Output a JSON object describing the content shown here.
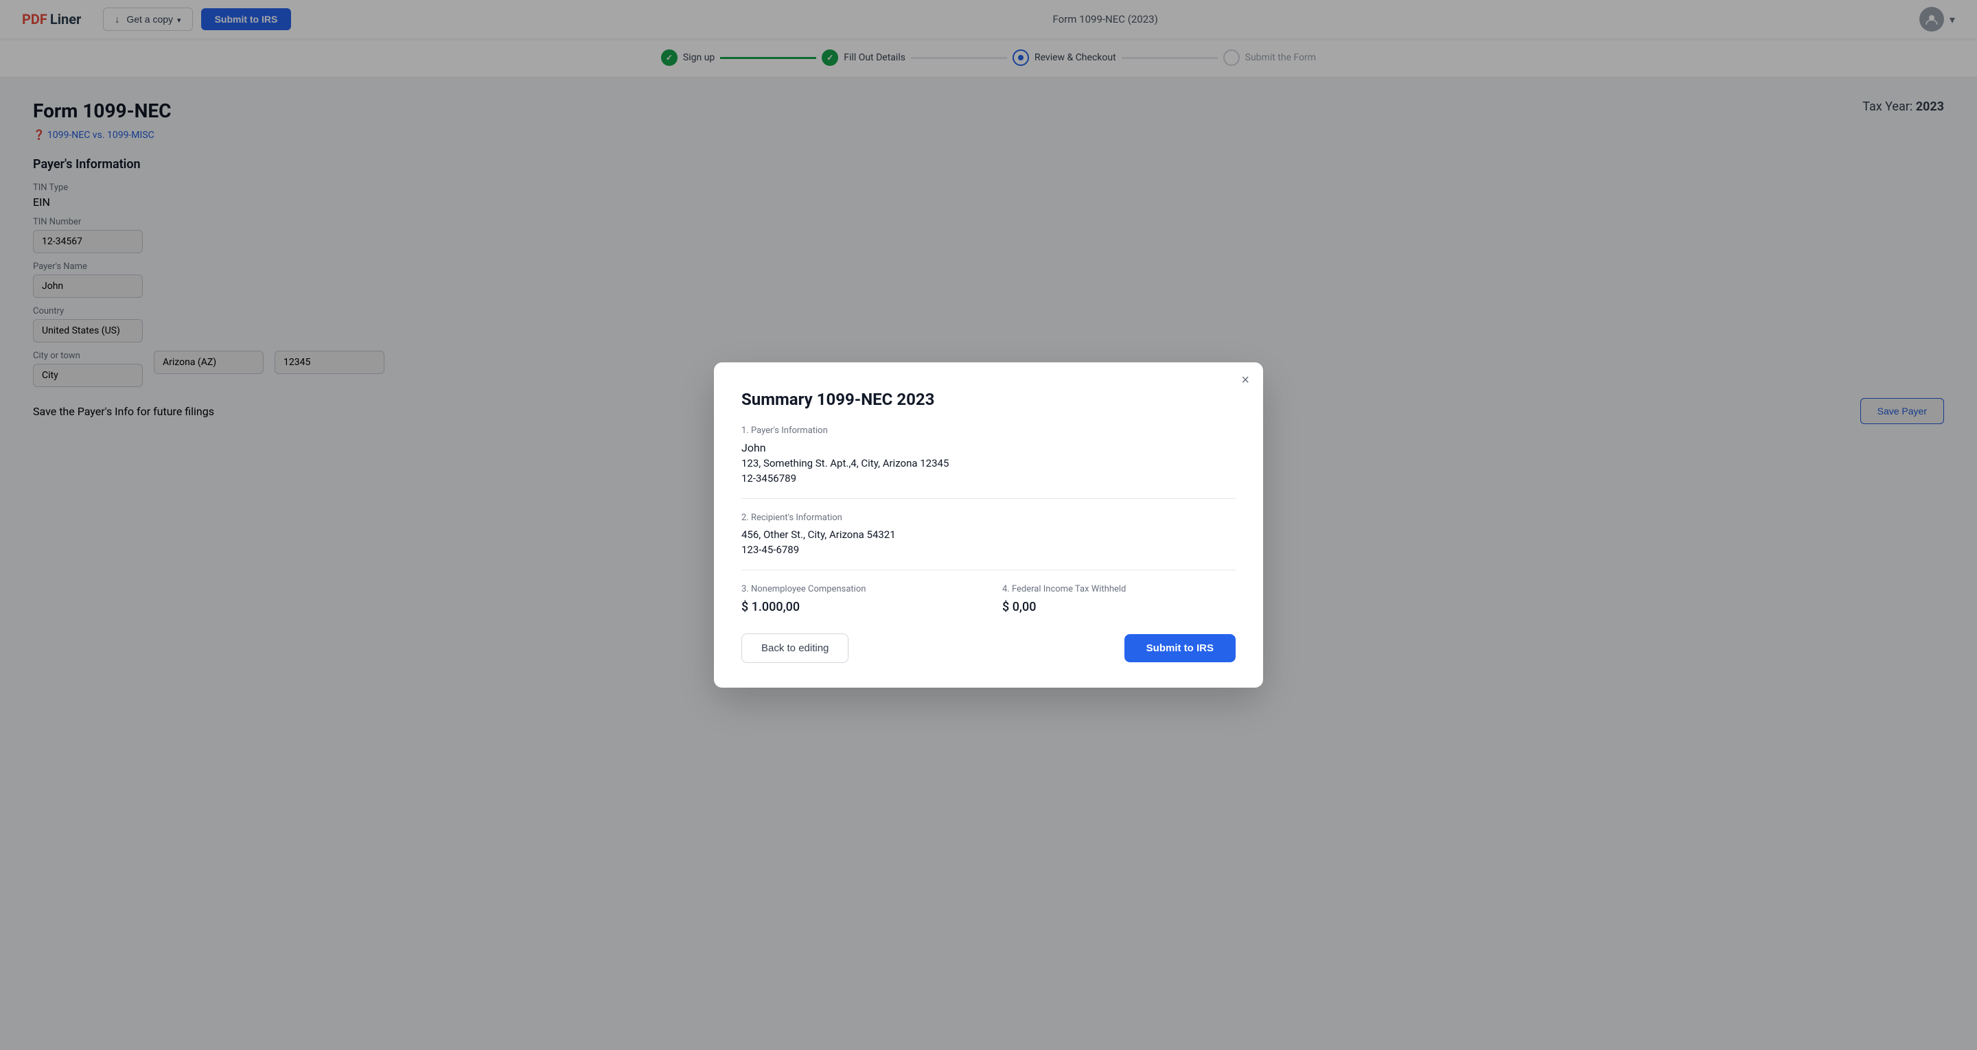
{
  "header": {
    "logo_pdf": "PDF",
    "logo_liner": "Liner",
    "get_copy_label": "Get a copy",
    "submit_irs_label": "Submit to IRS",
    "form_title": "Form 1099-NEC (2023)"
  },
  "progress": {
    "steps": [
      {
        "id": "sign-up",
        "label": "Sign up",
        "state": "done"
      },
      {
        "id": "fill-out",
        "label": "Fill Out Details",
        "state": "done"
      },
      {
        "id": "review",
        "label": "Review & Checkout",
        "state": "active"
      },
      {
        "id": "submit",
        "label": "Submit the Form",
        "state": "inactive"
      }
    ]
  },
  "background": {
    "form_heading": "Form 1099-NEC",
    "link_text": "1099-NEC vs. 1099-MISC",
    "tax_year_label": "Tax Year:",
    "tax_year_value": "2023",
    "payer_section": "Payer's Information",
    "tin_type_label": "TIN Type",
    "tin_type_value": "EIN",
    "tin_number_label": "TIN Number",
    "tin_number_value": "12-34567",
    "payer_name_label": "Payer's Name",
    "payer_name_value": "John",
    "country_label": "Country",
    "country_value": "United States (US)",
    "city_label": "City or town",
    "city_value": "City",
    "state_value": "Arizona (AZ)",
    "zip_value": "12345",
    "save_payer_label": "Save Payer",
    "save_info_text": "Save the Payer's Info for future filings"
  },
  "modal": {
    "title": "Summary 1099-NEC 2023",
    "close_label": "×",
    "payer_section_label": "1. Payer's Information",
    "payer_name": "John",
    "payer_address": "123, Something St. Apt.,4, City, Arizona 12345",
    "payer_tin": "12-3456789",
    "recipient_section_label": "2. Recipient's Information",
    "recipient_address": "456, Other St., City, Arizona 54321",
    "recipient_tin": "123-45-6789",
    "nonemployee_label": "3. Nonemployee Compensation",
    "nonemployee_value": "$ 1.000,00",
    "federal_label": "4. Federal Income Tax Withheld",
    "federal_value": "$ 0,00",
    "back_label": "Back to editing",
    "submit_label": "Submit to IRS"
  }
}
